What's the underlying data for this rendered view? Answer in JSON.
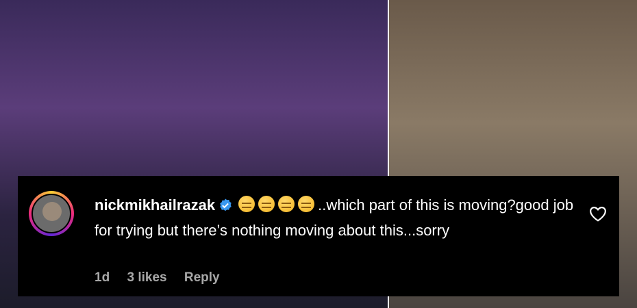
{
  "comment": {
    "username": "nickmikhailrazak",
    "text": "..which part of this is moving?good job for trying but there’s nothing moving about this...sorry",
    "emoji_count": 4,
    "emoji_name": "expressionless-face-emoji",
    "time": "1d",
    "likes": "3 likes",
    "reply_label": "Reply"
  },
  "colors": {
    "verified_badge": "#3897f0",
    "meta_text": "#a8a8a8"
  }
}
